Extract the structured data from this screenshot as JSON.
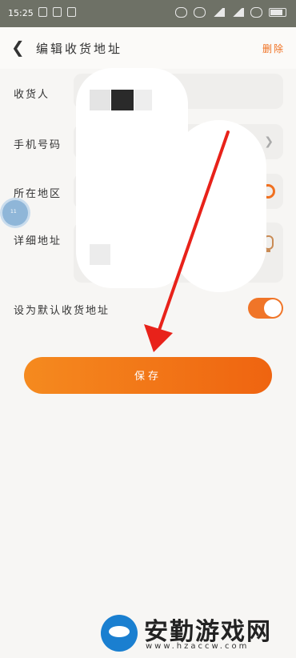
{
  "status_bar": {
    "time": "15:25"
  },
  "nav": {
    "title": "编辑收货地址",
    "delete_label": "删除"
  },
  "form": {
    "recipient_label": "收货人",
    "phone_label": "手机号码",
    "region_label": "所在地区",
    "address_label": "详细地址",
    "default_label": "设为默认收货地址",
    "default_on": true
  },
  "save_label": "保存",
  "floating_badge": "11",
  "watermark": {
    "title": "安勤游戏网",
    "url": "www.hzaccw.com"
  },
  "colors": {
    "accent": "#f07020",
    "annotation_arrow": "#e8221a"
  }
}
